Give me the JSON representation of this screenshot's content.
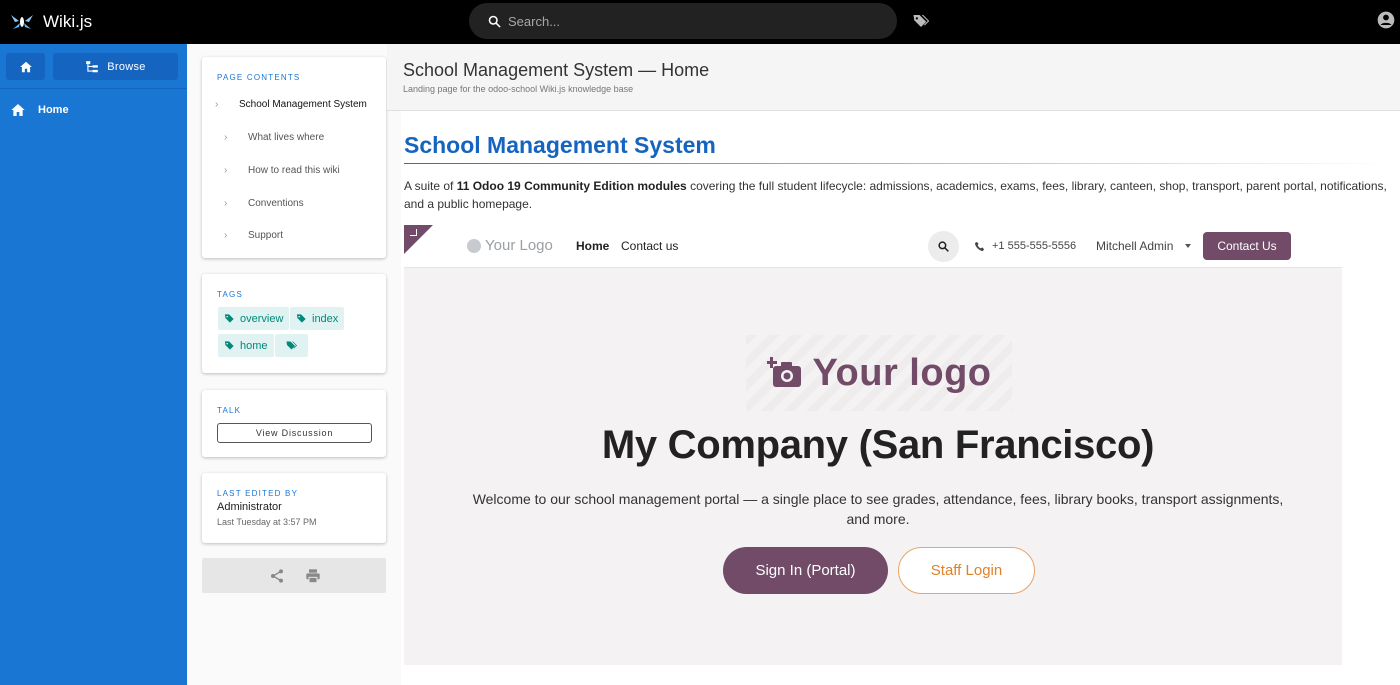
{
  "topbar": {
    "app_name": "Wiki.js",
    "search_placeholder": "Search..."
  },
  "sidenav": {
    "browse_label": "Browse",
    "items": [
      {
        "label": "Home"
      }
    ]
  },
  "toc": {
    "title": "PAGE CONTENTS",
    "main": "School Management System",
    "items": [
      "What lives where",
      "How to read this wiki",
      "Conventions",
      "Support"
    ]
  },
  "tags": {
    "title": "TAGS",
    "items": [
      "overview",
      "index",
      "home"
    ]
  },
  "talk": {
    "title": "TALK",
    "button": "View Discussion"
  },
  "last_edited": {
    "title": "LAST EDITED BY",
    "name": "Administrator",
    "time": "Last Tuesday at 3:57 PM"
  },
  "page": {
    "title": "School Management System — Home",
    "subtitle": "Landing page for the odoo-school Wiki.js knowledge base",
    "heading": "School Management System",
    "intro_pre": "A suite of ",
    "intro_bold": "11 Odoo 19 Community Edition modules",
    "intro_post": " covering the full student lifecycle: admissions, academics, exams, fees, library, canteen, shop, transport, parent portal, notifications, and a public homepage."
  },
  "odoo": {
    "logo_small": "Your Logo",
    "nav_home": "Home",
    "nav_contact": "Contact us",
    "phone": "+1 555-555-5556",
    "user": "Mitchell Admin",
    "contact_button": "Contact Us",
    "logo_big": "Your logo",
    "company": "My Company (San Francisco)",
    "welcome": "Welcome to our school management portal — a single place to see grades, attendance, fees, library books, transport assignments, and more.",
    "signin": "Sign In (Portal)",
    "staff_login": "Staff Login",
    "colors": {
      "primary": "#714b67",
      "secondary": "#e0812b"
    }
  },
  "colors": {
    "wiki_blue": "#1976d2",
    "teal_tag": "#00897b"
  }
}
